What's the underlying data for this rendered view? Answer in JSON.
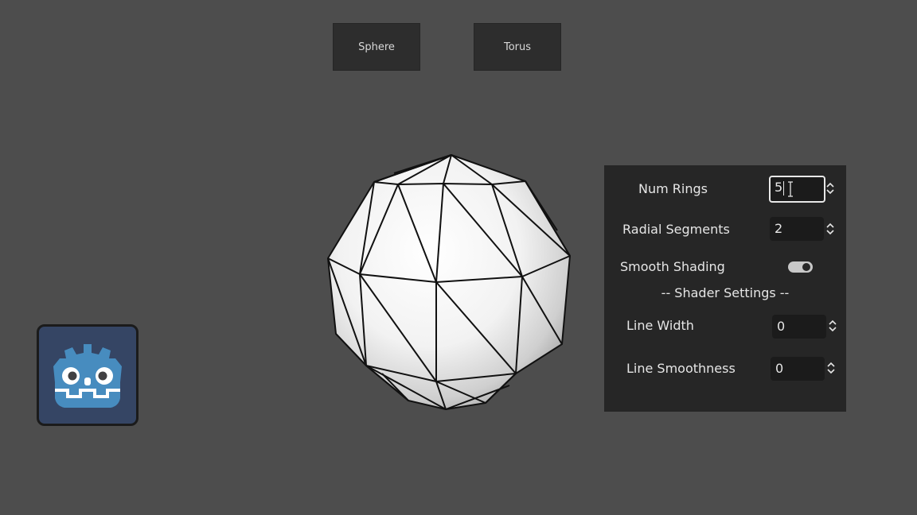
{
  "buttons": {
    "sphere_label": "Sphere",
    "torus_label": "Torus"
  },
  "panel": {
    "num_rings": {
      "label": "Num Rings",
      "value": "5"
    },
    "radial_segments": {
      "label": "Radial Segments",
      "value": "2"
    },
    "smooth_shading": {
      "label": "Smooth Shading",
      "enabled": true
    },
    "shader_section_title": "-- Shader Settings --",
    "line_width": {
      "label": "Line Width",
      "value": "0"
    },
    "line_smoothness": {
      "label": "Line Smoothness",
      "value": "0"
    }
  },
  "icons": {
    "logo": "godot-logo-icon",
    "spin_arrows": "up-down-arrows-icon",
    "text_cursor": "i-beam-cursor-icon"
  },
  "colors": {
    "background": "#4d4d4d",
    "panel": "#262626",
    "button": "#2d2d2d",
    "field": "#1b1b1b",
    "logo_bg": "#354564",
    "logo_blue": "#478cbf"
  }
}
